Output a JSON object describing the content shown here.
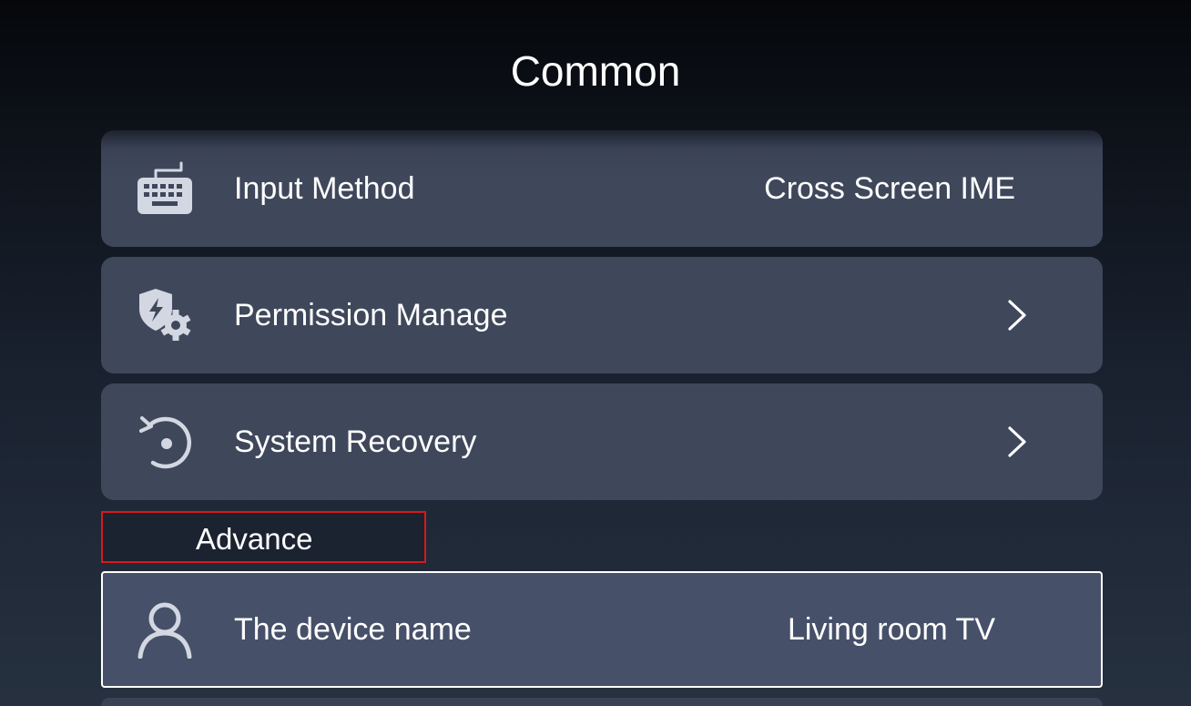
{
  "page": {
    "title": "Common"
  },
  "settings": [
    {
      "label": "Input Method",
      "value": "Cross Screen IME",
      "icon": "keyboard-icon"
    },
    {
      "label": "Permission Manage",
      "value": "",
      "icon": "shield-gear-icon",
      "has_chevron": true
    },
    {
      "label": "System Recovery",
      "value": "",
      "icon": "recovery-icon",
      "has_chevron": true
    }
  ],
  "advance": {
    "header": "Advance",
    "items": [
      {
        "label": "The device name",
        "value": "Living room TV",
        "icon": "user-icon",
        "focused": true
      }
    ]
  },
  "colors": {
    "row_background": "#3f475b",
    "focused_row_background": "#465069",
    "highlight_border": "#d8181e",
    "text": "#ffffff",
    "icon": "#d3d7e2"
  }
}
